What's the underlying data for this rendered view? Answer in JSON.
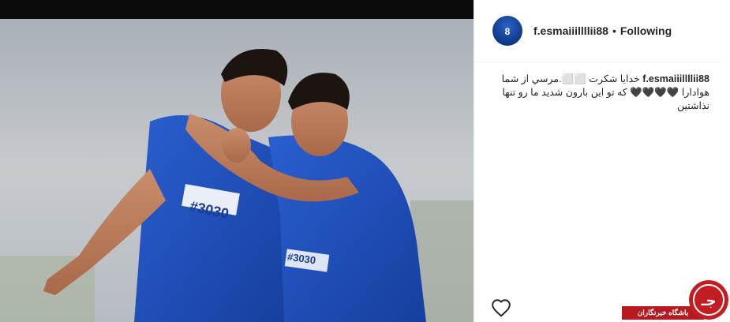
{
  "post": {
    "image_alt_hint": "",
    "jersey_text": "#3030",
    "jersey_text_2": "#3030"
  },
  "header": {
    "username": "f.esmaiiillllii88",
    "separator": "•",
    "follow_status": "Following",
    "avatar_number": "8"
  },
  "caption": {
    "username": "f.esmaiiillllii88",
    "text": "خدایا شکرت ⬜⬜.مرسي از شما هوادارا 🖤🖤🖤🖤 که تو این بارون شدید ما رو تنها نذاشتین"
  },
  "watermark": {
    "label": "باشگاه خبرنگاران",
    "logo_letters": "جـ"
  },
  "colors": {
    "jersey_blue": "#1e4fc0",
    "watermark_red": "#b8191f"
  }
}
